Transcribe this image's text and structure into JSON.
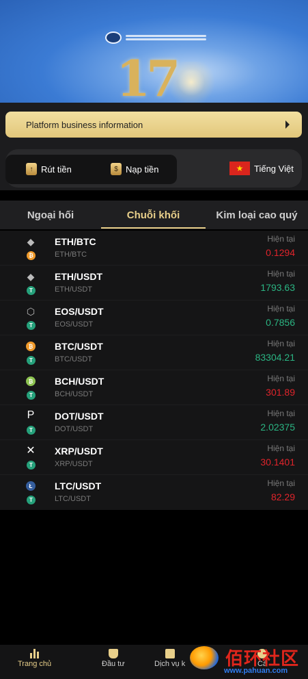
{
  "platform": {
    "label": "Platform business information"
  },
  "quick_actions": {
    "withdraw": "Rút tiền",
    "deposit": "Nạp tiền",
    "language": "Tiếng Việt"
  },
  "tabs": [
    "Ngoại hối",
    "Chuỗi khối",
    "Kim loại cao quý"
  ],
  "market": {
    "current_label": "Hiện tại",
    "rows": [
      {
        "pair": "ETH/BTC",
        "sub": "ETH/BTC",
        "price": "0.1294",
        "trend": "down",
        "main_icon": "ethereum-icon",
        "quote_icon": "bitcoin-icon"
      },
      {
        "pair": "ETH/USDT",
        "sub": "ETH/USDT",
        "price": "1793.63",
        "trend": "up",
        "main_icon": "ethereum-icon",
        "quote_icon": "tether-icon"
      },
      {
        "pair": "EOS/USDT",
        "sub": "EOS/USDT",
        "price": "0.7856",
        "trend": "up",
        "main_icon": "eos-icon",
        "quote_icon": "tether-icon"
      },
      {
        "pair": "BTC/USDT",
        "sub": "BTC/USDT",
        "price": "83304.21",
        "trend": "up",
        "main_icon": "bitcoin-icon",
        "quote_icon": "tether-icon"
      },
      {
        "pair": "BCH/USDT",
        "sub": "BCH/USDT",
        "price": "301.89",
        "trend": "down",
        "main_icon": "bitcoin-cash-icon",
        "quote_icon": "tether-icon"
      },
      {
        "pair": "DOT/USDT",
        "sub": "DOT/USDT",
        "price": "2.02375",
        "trend": "up",
        "main_icon": "polkadot-icon",
        "quote_icon": "tether-icon"
      },
      {
        "pair": "XRP/USDT",
        "sub": "XRP/USDT",
        "price": "30.1401",
        "trend": "down",
        "main_icon": "xrp-icon",
        "quote_icon": "tether-icon"
      },
      {
        "pair": "LTC/USDT",
        "sub": "LTC/USDT",
        "price": "82.29",
        "trend": "down",
        "main_icon": "litecoin-icon",
        "quote_icon": "tether-icon"
      }
    ]
  },
  "bottom_nav": [
    {
      "label": "Trang chủ",
      "active": true
    },
    {
      "label": "Đầu tư",
      "active": false
    },
    {
      "label": "Dịch vụ k",
      "active": false
    },
    {
      "label": "Cá",
      "active": false
    }
  ],
  "watermark": {
    "text": "佰环社区",
    "url": "www.pahuan.com"
  },
  "colors": {
    "accent": "#e8cf8a",
    "up": "#2bb583",
    "down": "#e0242b",
    "platform_bar": "#e9d48e"
  }
}
